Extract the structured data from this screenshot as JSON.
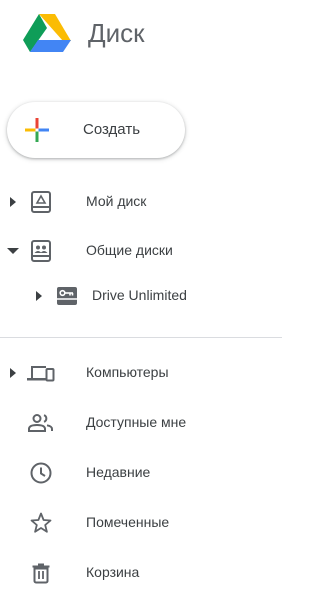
{
  "header": {
    "app_title": "Диск",
    "logo_icon": "google-drive-logo"
  },
  "create_button": {
    "label": "Создать",
    "icon": "plus-icon",
    "colors": [
      "#4285f4",
      "#ea4335",
      "#fbbc04",
      "#34a853"
    ]
  },
  "nav": {
    "items": [
      {
        "label": "Мой диск",
        "icon": "my-drive-icon",
        "expand_state": "collapsed"
      },
      {
        "label": "Общие диски",
        "icon": "shared-drives-icon",
        "expand_state": "expanded"
      },
      {
        "label": "Drive Unlimited",
        "icon": "shared-drive-icon",
        "expand_state": "collapsed"
      },
      {
        "label": "Компьютеры",
        "icon": "computers-icon",
        "expand_state": "collapsed"
      },
      {
        "label": "Доступные мне",
        "icon": "shared-with-me-icon"
      },
      {
        "label": "Недавние",
        "icon": "recent-clock-icon"
      },
      {
        "label": "Помеченные",
        "icon": "star-icon"
      },
      {
        "label": "Корзина",
        "icon": "trash-icon"
      }
    ]
  },
  "colors": {
    "icon": "#5f6368",
    "text": "#3c4043",
    "divider": "#dadce0"
  }
}
